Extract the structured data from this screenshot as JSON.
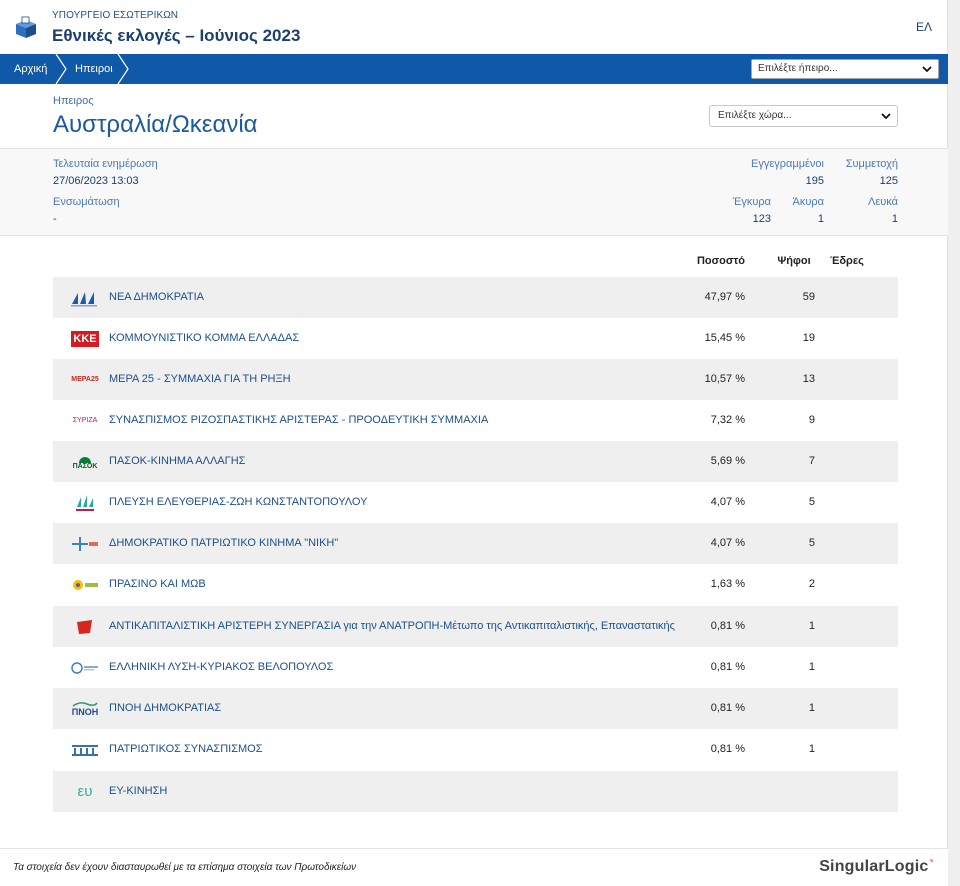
{
  "header": {
    "ministry": "ΥΠΟΥΡΓΕΙΟ ΕΣΩΤΕΡΙΚΩΝ",
    "title": "Εθνικές εκλογές – Ιούνιος 2023",
    "language": "ΕΛ"
  },
  "breadcrumb": {
    "home": "Αρχική",
    "current": "Ηπειροι"
  },
  "nav_select": {
    "placeholder": "Επιλέξτε ήπειρο..."
  },
  "region": {
    "label": "Ηπειρος",
    "name": "Αυστραλία/Ωκεανία",
    "country_select": "Επιλέξτε χώρα..."
  },
  "info": {
    "last_update_label": "Τελευταία ενημέρωση",
    "last_update_value": "27/06/2023 13:03",
    "integration_label": "Ενσωμάτωση",
    "integration_value": "-",
    "registered_label": "Εγγεγραμμένοι",
    "registered_value": "195",
    "turnout_label": "Συμμετοχή",
    "turnout_value": "125",
    "valid_label": "Έγκυρα",
    "valid_value": "123",
    "invalid_label": "Άκυρα",
    "invalid_value": "1",
    "blank_label": "Λευκά",
    "blank_value": "1"
  },
  "table": {
    "headers": {
      "percent": "Ποσοστό",
      "votes": "Ψήφοι",
      "seats": "Έδρες"
    },
    "rows": [
      {
        "name": "ΝΕΑ ΔΗΜΟΚΡΑΤΙΑ",
        "percent": "47,97 %",
        "votes": "59",
        "logo": "nd-logo"
      },
      {
        "name": "ΚΟΜΜΟΥΝΙΣΤΙΚΟ ΚΟΜΜΑ ΕΛΛΑΔΑΣ",
        "percent": "15,45 %",
        "votes": "19",
        "logo": "kke-logo",
        "logo_text": "ΚΚΕ"
      },
      {
        "name": "ΜΕΡΑ 25 - ΣΥΜΜΑΧΙΑ ΓΙΑ ΤΗ ΡΗΞΗ",
        "percent": "10,57 %",
        "votes": "13",
        "logo": "mera25-logo",
        "logo_text": "ΜΕΡΑ25"
      },
      {
        "name": "ΣΥΝΑΣΠΙΣΜΟΣ ΡΙΖΟΣΠΑΣΤΙΚΗΣ ΑΡΙΣΤΕΡΑΣ - ΠΡΟΟΔΕΥΤΙΚΗ ΣΥΜΜΑΧΙΑ",
        "percent": "7,32 %",
        "votes": "9",
        "logo": "syriza-logo",
        "logo_text": "ΣΥΡΙΖΑ"
      },
      {
        "name": "ΠΑΣΟΚ-ΚΙΝΗΜΑ ΑΛΛΑΓΗΣ",
        "percent": "5,69 %",
        "votes": "7",
        "logo": "pasok-logo",
        "logo_text": "ΠΑΣΟΚ"
      },
      {
        "name": "ΠΛΕΥΣΗ ΕΛΕΥΘΕΡΙΑΣ-ΖΩΗ ΚΩΝΣΤΑΝΤΟΠΟΥΛΟΥ",
        "percent": "4,07 %",
        "votes": "5",
        "logo": "plefsi-logo"
      },
      {
        "name": "ΔΗΜΟΚΡΑΤΙΚΟ ΠΑΤΡΙΩΤΙΚΟ ΚΙΝΗΜΑ \"ΝΙΚΗ\"",
        "percent": "4,07 %",
        "votes": "5",
        "logo": "niki-logo"
      },
      {
        "name": "ΠΡΑΣΙΝΟ ΚΑΙ ΜΩΒ",
        "percent": "1,63 %",
        "votes": "2",
        "logo": "prasino-logo"
      },
      {
        "name": "ΑΝΤΙΚΑΠΙΤΑΛΙΣΤΙΚΗ ΑΡΙΣΤΕΡΗ ΣΥΝΕΡΓΑΣΙΑ για την ΑΝΑΤΡΟΠΗ-Μέτωπο της Αντικαπιταλιστικής, Επαναστατικής",
        "percent": "0,81 %",
        "votes": "1",
        "logo": "antarsya-logo"
      },
      {
        "name": "ΕΛΛΗΝΙΚΗ ΛΥΣΗ-ΚΥΡΙΑΚΟΣ ΒΕΛΟΠΟΥΛΟΣ",
        "percent": "0,81 %",
        "votes": "1",
        "logo": "elliniki-lysi-logo"
      },
      {
        "name": "ΠΝΟΗ ΔΗΜΟΚΡΑΤΙΑΣ",
        "percent": "0,81 %",
        "votes": "1",
        "logo": "pnoi-logo",
        "logo_text": "ΠΝΟΗ"
      },
      {
        "name": "ΠΑΤΡΙΩΤΙΚΟΣ ΣΥΝΑΣΠΙΣΜΟΣ",
        "percent": "0,81 %",
        "votes": "1",
        "logo": "patriotikos-logo"
      },
      {
        "name": "ΕΥ-ΚΙΝΗΣΗ",
        "percent": "",
        "votes": "",
        "logo": "ey-kinisi-logo",
        "logo_text": "ευ"
      }
    ]
  },
  "footer": {
    "disclaimer": "Τα στοιχεία δεν έχουν διασταυρωθεί με τα επίσημα στοιχεία των Πρωτοδικείων",
    "brand_main": "SingularLogic",
    "brand_mark": "˺"
  },
  "colors": {
    "navbar": "#0f59a8",
    "title": "#1b3f73",
    "link": "#1b4f8f",
    "row_alt": "#efefef",
    "brand_accent": "#e0351b"
  }
}
